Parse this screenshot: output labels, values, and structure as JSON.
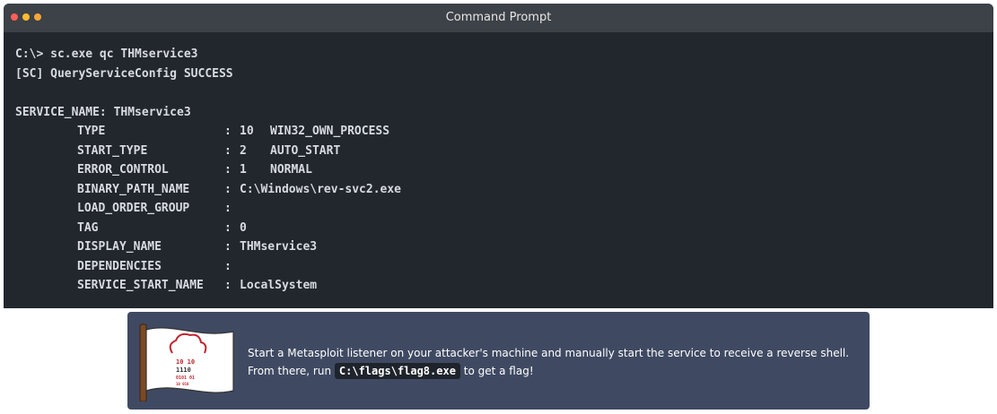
{
  "window": {
    "title": "Command Prompt"
  },
  "terminal": {
    "prompt_line": "C:\\> sc.exe qc THMservice3",
    "status_line": "[SC] QueryServiceConfig SUCCESS",
    "service_line": "SERVICE_NAME: THMservice3",
    "rows": [
      {
        "key": "TYPE",
        "num": "10",
        "val": "WIN32_OWN_PROCESS"
      },
      {
        "key": "START_TYPE",
        "num": "2",
        "val": "AUTO_START"
      },
      {
        "key": "ERROR_CONTROL",
        "num": "1",
        "val": "NORMAL"
      },
      {
        "key": "BINARY_PATH_NAME",
        "num": "",
        "val": "C:\\Windows\\rev-svc2.exe"
      },
      {
        "key": "LOAD_ORDER_GROUP",
        "num": "",
        "val": ""
      },
      {
        "key": "TAG",
        "num": "",
        "val": "0"
      },
      {
        "key": "DISPLAY_NAME",
        "num": "",
        "val": "THMservice3"
      },
      {
        "key": "DEPENDENCIES",
        "num": "",
        "val": ""
      },
      {
        "key": "SERVICE_START_NAME",
        "num": "",
        "val": "LocalSystem"
      }
    ],
    "separator": ":"
  },
  "note": {
    "line1": "Start a Metasploit listener on your attacker's machine and manually start the service to receive a reverse shell.",
    "line2_pre": "From there, run ",
    "code": "C:\\flags\\flag8.exe",
    "line2_post": " to get a flag!",
    "icon": "flag-icon",
    "flag_text": [
      "10 10",
      "1110",
      "0101 01",
      "10 010"
    ]
  },
  "colors": {
    "terminal_bg": "#22272e",
    "titlebar_bg": "#3d4148",
    "note_bg": "#3f4a62",
    "flag_red": "#c0262d"
  }
}
